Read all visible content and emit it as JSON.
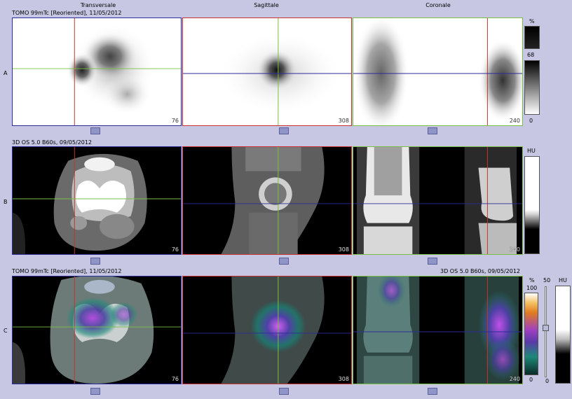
{
  "columns": {
    "transversal": "Transversale",
    "sagittal": "Sagittale",
    "coronal": "Coronale"
  },
  "rows": {
    "a": {
      "label": "A",
      "title": "TOMO 99mTc [Reoriented], 11/05/2012"
    },
    "b": {
      "label": "B",
      "title": "3D OS 5.0 B60s, 09/05/2012"
    },
    "c": {
      "label": "C",
      "title_left": "TOMO 99mTc [Reoriented], 11/05/2012",
      "title_right": "3D OS 5.0 B60s, 09/05/2012"
    }
  },
  "slices": {
    "a_trans": "76",
    "a_sag": "308",
    "a_cor": "240",
    "b_trans": "76",
    "b_sag": "308",
    "b_cor": "240",
    "c_trans": "76",
    "c_sag": "308",
    "c_cor": "240"
  },
  "scales": {
    "a_unit": "%",
    "a_mid": "68",
    "a_min": "0",
    "b_unit": "HU",
    "c_unit_pct": "%",
    "c_max_pct": "100",
    "c_min_pct": "0",
    "c_slider_max": "50",
    "c_slider_min": "0",
    "c_unit_hu": "HU"
  },
  "colors": {
    "background": "#c7c7e3",
    "border_red": "#c83232",
    "border_green": "#7ac043",
    "border_blue": "#2c2c9a",
    "crosshair_red": "#c83232",
    "crosshair_green": "#7ac043",
    "crosshair_blue": "#2c2c9a"
  },
  "icons": [
    "scrollbar-thumb",
    "crosshair"
  ]
}
